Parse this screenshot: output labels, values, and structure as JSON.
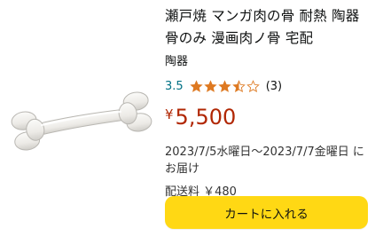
{
  "product": {
    "title": "瀬戸焼 マンガ肉の骨 耐熱 陶器 骨のみ 漫画肉ノ骨 宅配",
    "seller": "陶器",
    "rating": {
      "value_label": "3.5",
      "value": 3.5,
      "max": 5,
      "review_count_label": "(3)",
      "star_color": "#de7921"
    },
    "price": {
      "symbol": "¥",
      "amount": "5,500",
      "color": "#b12704"
    },
    "delivery_text": "2023/7/5水曜日～2023/7/7金曜日 にお届け",
    "shipping_text": "配送料 ￥480"
  },
  "actions": {
    "add_to_cart_label": "カートに入れる",
    "button_color": "#ffd814"
  }
}
